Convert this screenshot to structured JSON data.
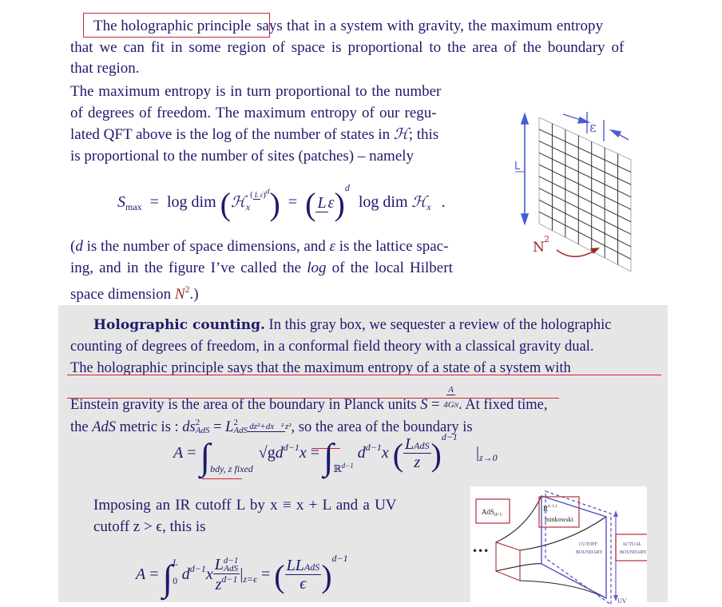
{
  "section1": {
    "boxed_phrase": "The holographic principle",
    "line1_rest": "says that in a system with gravity, the maximum entropy",
    "line2": "that we can fit in some region of space is proportional to the area of the boundary of",
    "line3": "that region."
  },
  "section2": {
    "lines": [
      "The maximum entropy is in turn proportional to the number",
      "of degrees of freedom.  The maximum entropy of our regu-",
      "lated QFT above is the log of the number of states in",
      "is proportional to the number of sites (patches) – namely"
    ],
    "line3_symbol": "ℋ",
    "line3_tail": "; this"
  },
  "equation1": {
    "lhs": "S",
    "lhs_sub": "max",
    "eq": "=",
    "logdim": "log dim",
    "H": "ℋ",
    "x": "x",
    "L": "L",
    "eps": "ε",
    "d": "d",
    "period": "."
  },
  "section3": {
    "line1_pre": "(",
    "d": "d",
    "line1_mid": " is the number of space dimensions, and ",
    "eps": "ε",
    "line1_post": " is the lattice spac-",
    "line2_pre": "ing, and in the figure I’ve called the ",
    "line2_italic": "log",
    "line2_post": " of the local Hilbert",
    "line3_pre": "space dimension ",
    "N": "N",
    "two": "2",
    "line3_post": ".)"
  },
  "figure1": {
    "label_L": "L",
    "label_eps": "ε",
    "label_N": "N",
    "label_N_exp": "2"
  },
  "graybox": {
    "title": "Holographic counting.",
    "line1_rest": " In this gray box, we sequester a review of the holographic",
    "line2": "counting of degrees of freedom, in a conformal field theory with a classical gravity dual.",
    "line3": "The holographic principle says that the maximum entropy of a state of a system with",
    "line4": "Einstein gravity is the area of the boundary in Planck units ",
    "line4_S": "S",
    "line4_num": "A",
    "line4_den": "4G",
    "line4_den_sub": "N",
    "line4_tail": ". At fixed time,",
    "line5_pre": "the ",
    "line5_ads": "AdS",
    "line5_mid": " metric is : ",
    "line5_ds": "ds",
    "line5_eqL": "L",
    "line5_num": "dz²+dx⃗²",
    "line5_den": "z²",
    "line5_tail": ", so the area of the boundary is",
    "eq2": {
      "A": "A",
      "sub1": "bdy,  z  fixed",
      "sqrtg": "√g",
      "d": "d",
      "dm1": "d−1",
      "x": "x",
      "R": "ℝ",
      "LAdS": "L",
      "AdS": "AdS",
      "z": "z",
      "limit": "z→0"
    },
    "imposing_line1": "Imposing an IR cutoff L by x ≡ x + L and a UV",
    "imposing_line2": "cutoff z > ϵ, this is",
    "eq3": {
      "A": "A",
      "upper": "L",
      "lower": "0",
      "num": "L",
      "den": "z",
      "eval": "z=ϵ",
      "rnum": "LL",
      "rden": "ϵ"
    }
  },
  "figure2": {
    "ads_label": "AdS",
    "ads_sub": "d+1",
    "mink_R": "R",
    "mink_sup": "d−1,1",
    "mink_label": "minkowski",
    "cutoff_1": "CUTOFF",
    "cutoff_2": "BOUNDARY",
    "actual_1": "ACTUAL",
    "actual_2": "BOUNDARY",
    "uv": "UV",
    "dots": "•••"
  }
}
